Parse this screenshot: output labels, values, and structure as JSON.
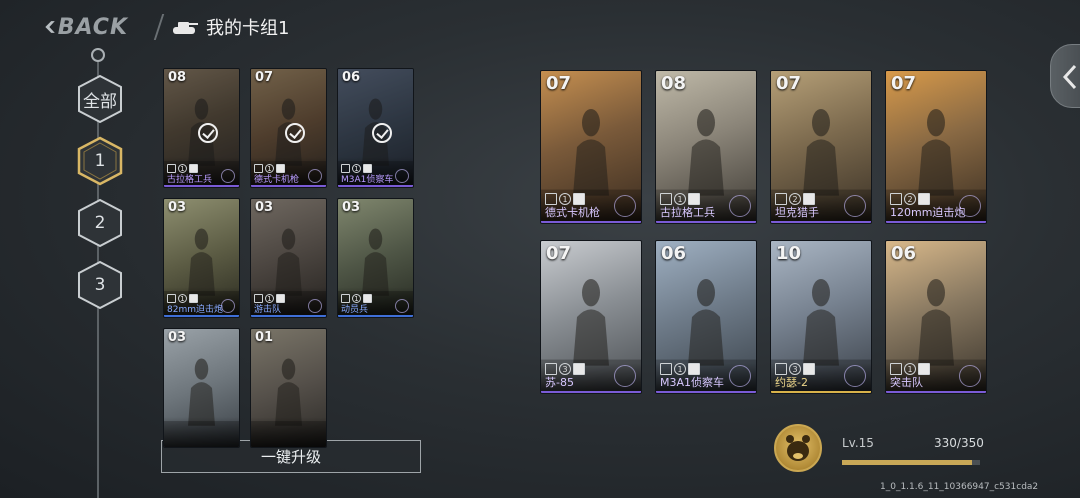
{
  "header": {
    "back_label": "BACK",
    "deck_title": "我的卡组1"
  },
  "deck_tabs": [
    {
      "label": "全部",
      "selected": false
    },
    {
      "label": "1",
      "selected": true
    },
    {
      "label": "2",
      "selected": false
    },
    {
      "label": "3",
      "selected": false
    }
  ],
  "left_cards": [
    {
      "cost": "08",
      "name": "古拉格工兵",
      "stat": "1",
      "in_deck": true,
      "rarity": "purple"
    },
    {
      "cost": "07",
      "name": "德式卡机枪",
      "stat": "1",
      "in_deck": true,
      "rarity": "purple"
    },
    {
      "cost": "06",
      "name": "M3A1侦察车",
      "stat": "1",
      "in_deck": true,
      "rarity": "purple"
    },
    {
      "cost": "03",
      "name": "82mm迫击炮",
      "stat": "1",
      "in_deck": false,
      "rarity": "blue"
    },
    {
      "cost": "03",
      "name": "游击队",
      "stat": "1",
      "in_deck": false,
      "rarity": "blue"
    },
    {
      "cost": "03",
      "name": "动员兵",
      "stat": "1",
      "in_deck": false,
      "rarity": "blue"
    },
    {
      "cost": "03",
      "name": "",
      "stat": "",
      "in_deck": false,
      "rarity": "none"
    },
    {
      "cost": "01",
      "name": "",
      "stat": "",
      "in_deck": false,
      "rarity": "none"
    }
  ],
  "deck_cards": [
    {
      "cost": "07",
      "name": "德式卡机枪",
      "stat": "1",
      "rarity": "purple"
    },
    {
      "cost": "08",
      "name": "古拉格工兵",
      "stat": "1",
      "rarity": "purple"
    },
    {
      "cost": "07",
      "name": "坦克猎手",
      "stat": "2",
      "rarity": "purple"
    },
    {
      "cost": "07",
      "name": "120mm迫击炮",
      "stat": "2",
      "rarity": "purple"
    },
    {
      "cost": "07",
      "name": "苏-85",
      "stat": "3",
      "rarity": "purple"
    },
    {
      "cost": "06",
      "name": "M3A1侦察车",
      "stat": "1",
      "rarity": "purple"
    },
    {
      "cost": "10",
      "name": "约瑟-2",
      "stat": "3",
      "rarity": "gold"
    },
    {
      "cost": "06",
      "name": "突击队",
      "stat": "1",
      "rarity": "purple"
    }
  ],
  "upgrade_button": {
    "label": "一键升级"
  },
  "player": {
    "level": "Lv.15",
    "xp": "330/350",
    "xp_progress": 0.943
  },
  "build_id": "1_0_1.1.6_11_10366947_c531cda2",
  "colors": {
    "purple": "#7a5bd6",
    "gold": "#d8b24a",
    "blue": "#3f6fd8"
  }
}
